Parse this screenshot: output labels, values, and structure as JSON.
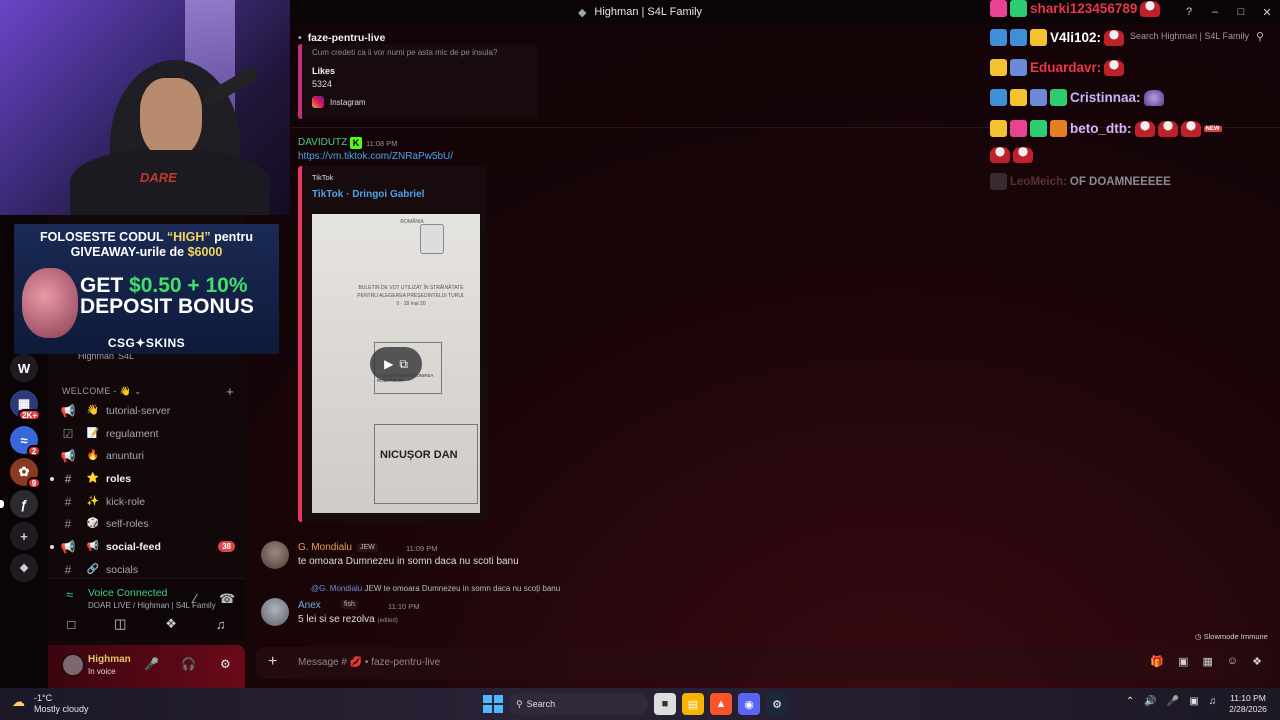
{
  "window": {
    "title": "Highman | S4L Family"
  },
  "header": {
    "channel_name": "faze-pentru-live",
    "search_placeholder": "Search Highman | S4L Family"
  },
  "chat_overlay": [
    {
      "user": "sharki123456789",
      "color": "#e8364b"
    },
    {
      "user": "V4li102:",
      "color": "#ffffff"
    },
    {
      "user": "Eduardavr:",
      "color": "#e8364b"
    },
    {
      "user": "Cristinnaa:",
      "color": "#c9b3ff"
    },
    {
      "user": "beto_dtb:",
      "color": "#d8b4ff"
    },
    {
      "user": "LeoMeich:",
      "message": "OF DOAMNEEEEE",
      "color": "#5b2f3a"
    }
  ],
  "webcam": {
    "shirt_text": "DARE"
  },
  "banner": {
    "line1_prefix": "FOLOSESTE CODUL ",
    "line1_code": "“HIGH”",
    "line1_suffix": " pentru",
    "line2_prefix": "GIVEAWAY-urile de ",
    "line2_amount": "$6000",
    "line3_prefix": "GET ",
    "line3_amount": "$0.50 + 10%",
    "line4": "DEPOSIT BONUS",
    "brand": "CSG✦SKINS"
  },
  "sidebar": {
    "server_name": "Highman",
    "server_tag": "S4L",
    "category": "WELCOME - 👋",
    "channels": [
      {
        "name": "tutorial-server",
        "emoji": "👋",
        "type": "announce",
        "unread": false
      },
      {
        "name": "regulament",
        "emoji": "📝",
        "type": "rules",
        "unread": false
      },
      {
        "name": "anunturi",
        "emoji": "🔥",
        "type": "announce",
        "unread": false
      },
      {
        "name": "roles",
        "emoji": "⭐",
        "type": "text",
        "unread": true
      },
      {
        "name": "kick-role",
        "emoji": "✨",
        "type": "text",
        "unread": false
      },
      {
        "name": "self-roles",
        "emoji": "🎲",
        "type": "text",
        "unread": false
      },
      {
        "name": "social-feed",
        "emoji": "📢",
        "type": "announce",
        "unread": true,
        "badge": "38"
      },
      {
        "name": "socials",
        "emoji": "🔗",
        "type": "text",
        "unread": false
      }
    ],
    "rail_badges": [
      "2K+",
      "2",
      "9"
    ],
    "voice": {
      "status": "Voice Connected",
      "location": "DOAR LIVE / Highman | S4L Family"
    },
    "user": {
      "name": "Highman",
      "status": "In voice"
    }
  },
  "messages": {
    "instagram_embed": {
      "faded_text": "Cum credeti ca ii vor numi pe asta mic de pe insula?",
      "likes_label": "Likes",
      "likes_value": "5324",
      "provider": "Instagram"
    },
    "msg1": {
      "author": "DAVIDUTZ",
      "time": "11:08 PM",
      "link": "https://vm.tiktok.com/ZNRaPw5bU/",
      "embed_provider": "TikTok",
      "embed_title": "TikTok · Dringoi Gabriel",
      "thumb_header": "ROMÂNIA",
      "thumb_lines": "BULETIN DE VOT UTILIZAT ÎN STRĂINĂTATE PENTRU ALEGEREA PREȘEDINTELUI TURUL II · 18 mai 20",
      "thumb_party": "ALIANȚA PENTRU UNIREA ROMÂNILOR",
      "thumb_candidate": "NICUȘOR DAN"
    },
    "msg2": {
      "author": "G. Mondialu",
      "role": "JEW",
      "time": "11:09 PM",
      "text": "te omoara Dumnezeu in somn daca nu scoti banu"
    },
    "msg3": {
      "reply_mention": "@G. Mondialu",
      "reply_role": "JEW",
      "reply_text": "te omoara Dumnezeu in somn daca nu scoți banu",
      "author": "Anex",
      "role": "fish",
      "time": "11:10 PM",
      "text": "5 lei si se rezolva",
      "edited": "(edited)"
    }
  },
  "slowmode": "Slowmode Immune",
  "composer": {
    "placeholder": "Message # 💋 • faze-pentru-live"
  },
  "taskbar": {
    "temp": "-1°C",
    "weather": "Mostly cloudy",
    "search": "Search",
    "time": "11:10 PM",
    "date": "2/28/2026"
  }
}
